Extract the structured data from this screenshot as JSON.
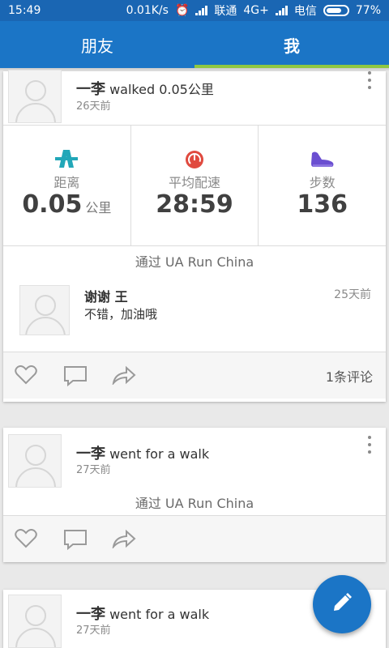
{
  "status_bar": {
    "time": "15:49",
    "net_speed": "0.01K/s",
    "carrier1": "联通",
    "network": "4G+",
    "carrier2": "电信",
    "battery": "77%",
    "battery_level": 0.77
  },
  "tabs": [
    {
      "label": "朋友",
      "active": false
    },
    {
      "label": "我",
      "active": true
    }
  ],
  "colors": {
    "primary": "#1b75c6",
    "tab_indicator": "#8fc741",
    "distance_icon": "#22a7b8",
    "pace_icon": "#e04a3f",
    "steps_icon": "#6b4fd1"
  },
  "posts": [
    {
      "user": "一李",
      "action": "walked 0.05公里",
      "time": "26天前",
      "stats": [
        {
          "icon": "distance-icon",
          "label": "距离",
          "value": "0.05",
          "unit": "公里"
        },
        {
          "icon": "speedometer-icon",
          "label": "平均配速",
          "value": "28:59",
          "unit": ""
        },
        {
          "icon": "shoe-icon",
          "label": "步数",
          "value": "136",
          "unit": ""
        }
      ],
      "via": "通过 UA Run China",
      "comment": {
        "name": "谢谢 王",
        "text": "不错，加油哦",
        "time": "25天前"
      },
      "comment_count": "1条评论"
    },
    {
      "user": "一李",
      "action": "went for a walk",
      "time": "27天前",
      "via": "通过 UA Run China"
    },
    {
      "user": "一李",
      "action": "went for a walk",
      "time": "27天前"
    }
  ],
  "fab": {
    "icon": "pencil-icon"
  }
}
